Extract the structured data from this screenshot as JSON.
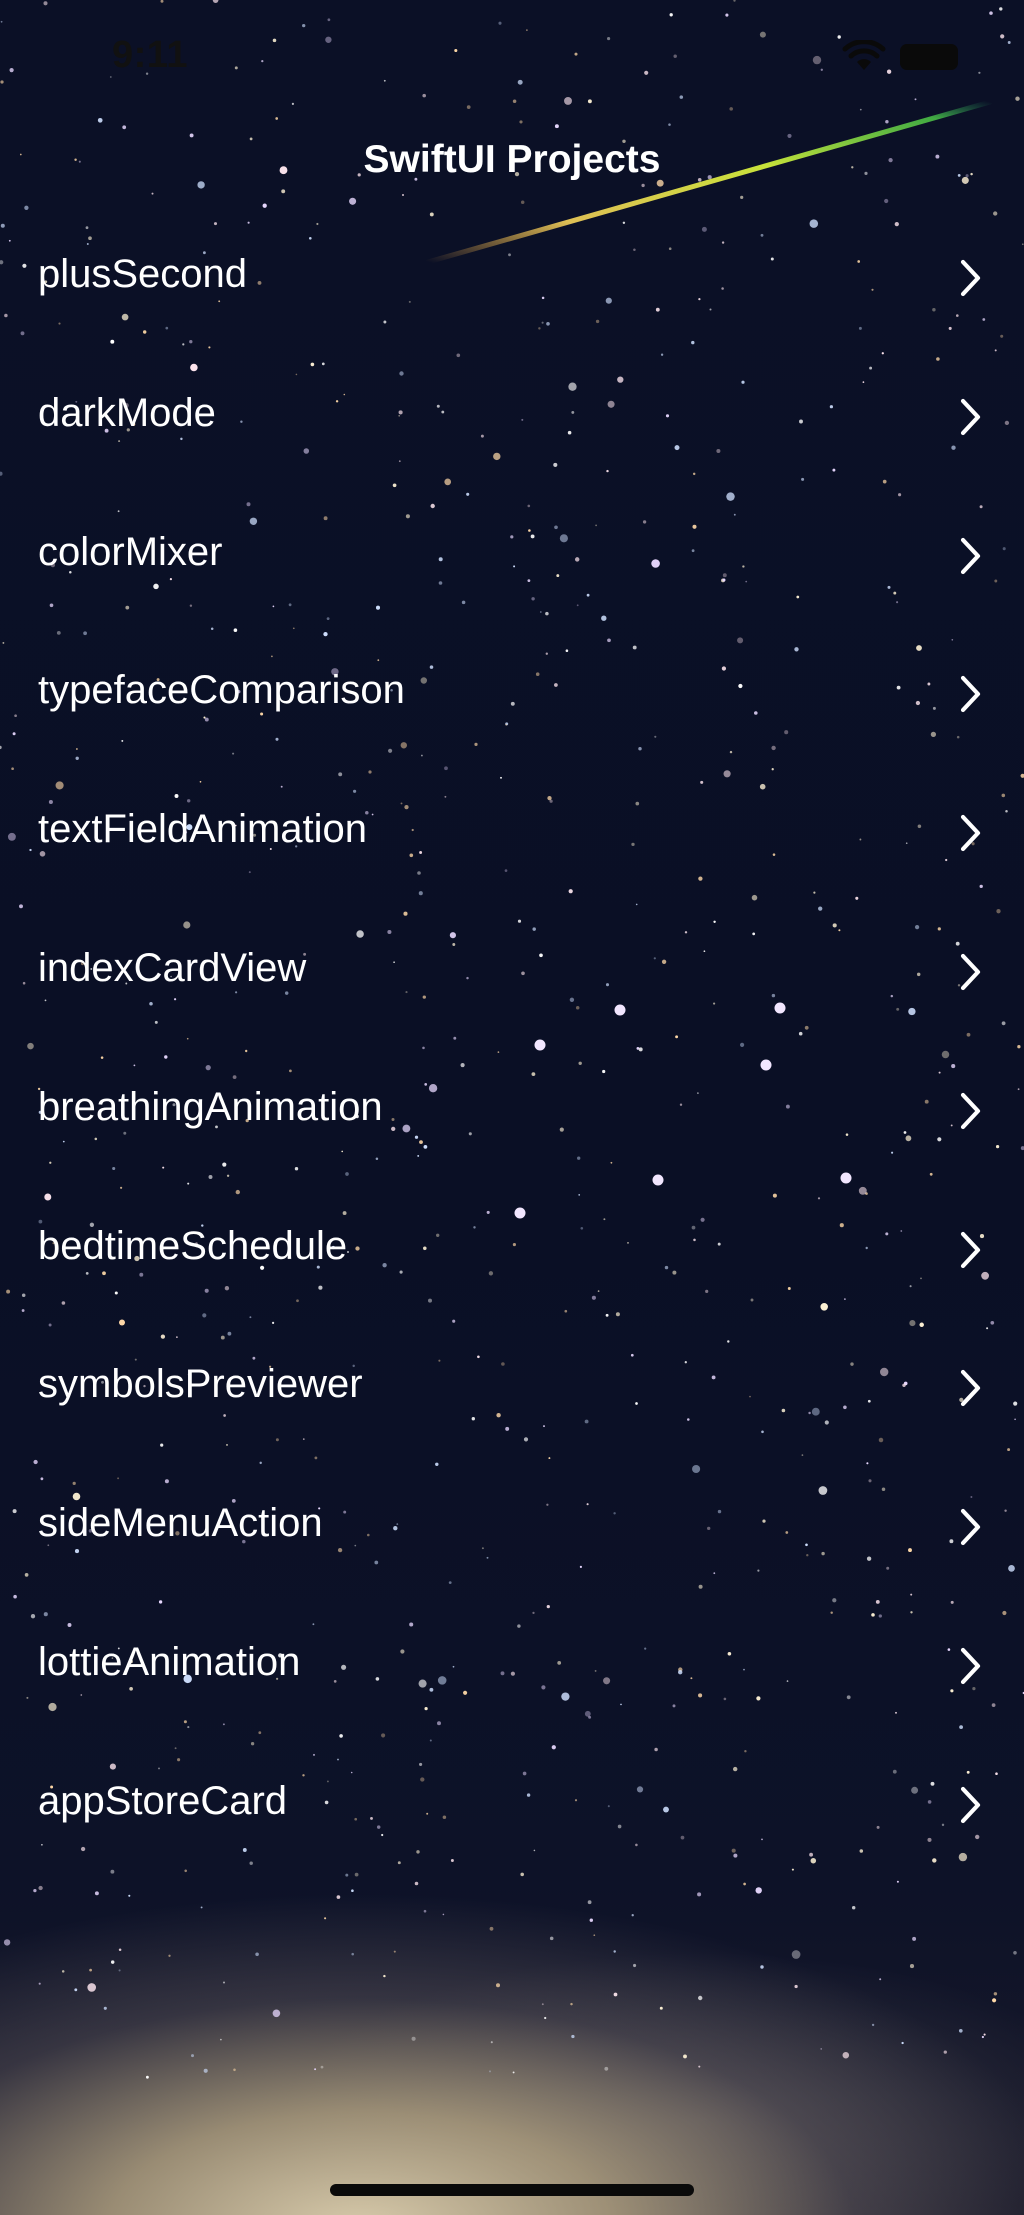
{
  "status_bar": {
    "time": "9:11"
  },
  "nav": {
    "title": "SwiftUI Projects"
  },
  "projects": [
    {
      "label": "plusSecond"
    },
    {
      "label": "darkMode"
    },
    {
      "label": "colorMixer"
    },
    {
      "label": "typefaceComparison"
    },
    {
      "label": "textFieldAnimation"
    },
    {
      "label": "indexCardView"
    },
    {
      "label": "breathingAnimation"
    },
    {
      "label": "bedtimeSchedule"
    },
    {
      "label": "symbolsPreviewer"
    },
    {
      "label": "sideMenuAction"
    },
    {
      "label": "lottieAnimation"
    },
    {
      "label": "appStoreCard"
    }
  ],
  "icons": {
    "row_disclosure": "chevron-right-icon",
    "wifi": "wifi-icon",
    "battery": "battery-icon"
  },
  "colors": {
    "text": "#ffffff",
    "background": "#0b1026",
    "status_bar_ink": "#111111"
  }
}
